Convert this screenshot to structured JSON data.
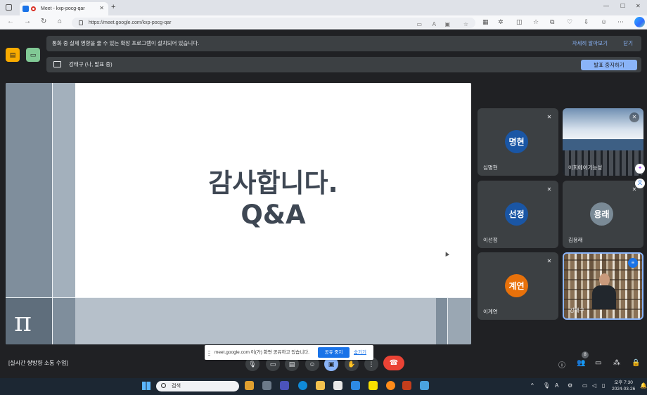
{
  "browser": {
    "tab_title": "Meet - kxp-pocg-qar",
    "url": "https://meet.google.com/kxp-pocg-qar"
  },
  "banners": {
    "extension_notice": "통화 중 실제 영향을 줄 수 있는 확장 프로그램이 설치되어 있습니다.",
    "learn_more": "자세히 알아보기",
    "close": "닫기",
    "presenting_label": "강태구 (나, 발표 중)",
    "stop_presenting": "발표 중지하기"
  },
  "slide": {
    "title_line1": "감사합니다.",
    "title_line2": "Q&A",
    "symbol": "π"
  },
  "participants": [
    {
      "initials": "명현",
      "name": "심명현",
      "color": "#1a56a5",
      "muted": true,
      "type": "avatar"
    },
    {
      "initials": "",
      "name": "이희에어기능성",
      "color": "",
      "muted": true,
      "type": "sea"
    },
    {
      "initials": "선정",
      "name": "이선정",
      "color": "#1a56a5",
      "muted": true,
      "type": "avatar"
    },
    {
      "initials": "용래",
      "name": "김용래",
      "color": "#7a8a96",
      "muted": true,
      "type": "avatar"
    },
    {
      "initials": "계연",
      "name": "이계연",
      "color": "#e8710a",
      "muted": true,
      "type": "avatar"
    },
    {
      "initials": "",
      "name": "강태구",
      "color": "",
      "muted": false,
      "type": "camera"
    }
  ],
  "bottom": {
    "meeting_title": "[실시간 쌍방향 소통 수업]",
    "share_notice": "meet.google.com 이(가) 화면 공유하고 있습니다.",
    "share_stop": "공유 중지",
    "share_hide": "숨기기",
    "people_count": "8"
  },
  "taskbar": {
    "search_placeholder": "검색",
    "time": "오후 7:30",
    "date": "2024-03-26"
  }
}
